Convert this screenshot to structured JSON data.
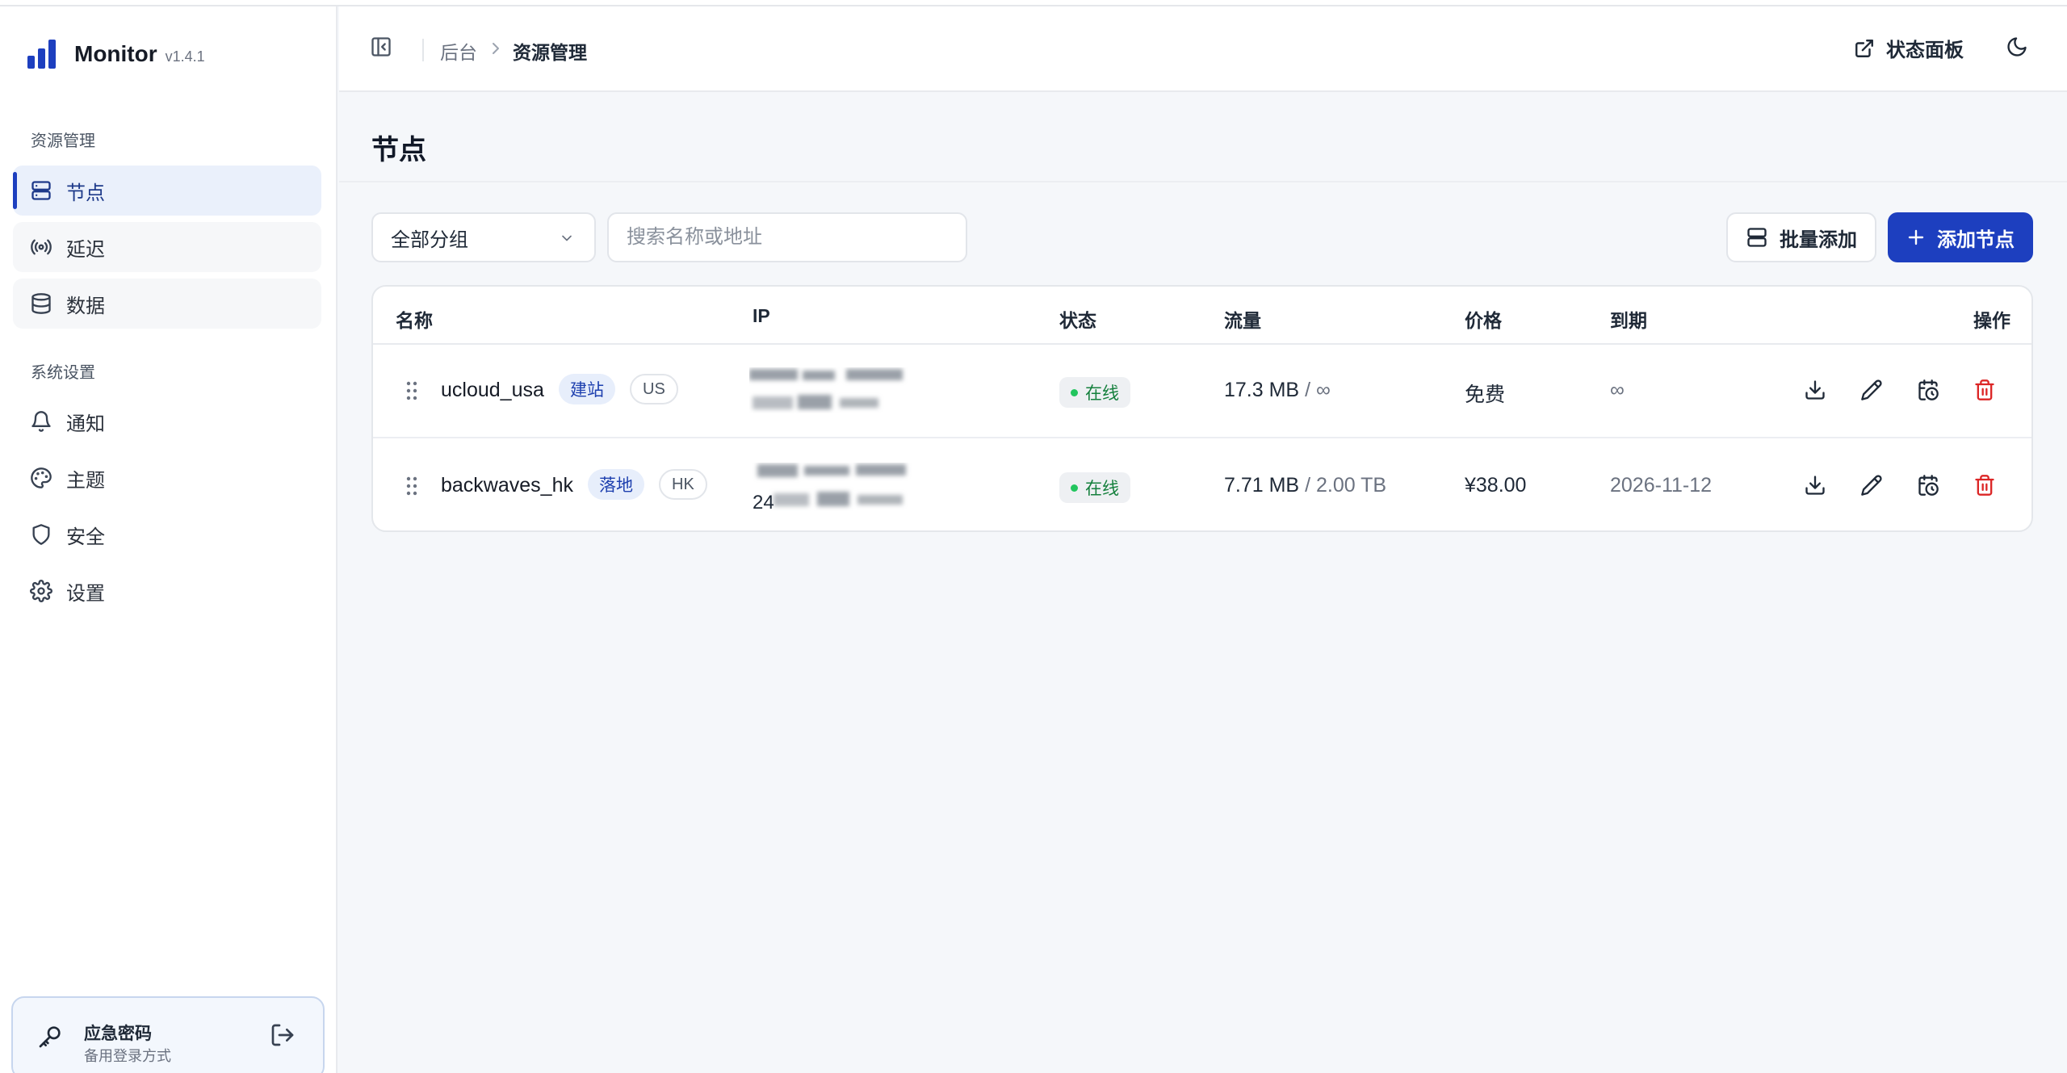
{
  "app": {
    "name": "Monitor",
    "version": "v1.4.1"
  },
  "sidebar": {
    "groups": [
      {
        "title": "资源管理",
        "items": [
          {
            "label": "节点",
            "icon": "server-icon",
            "active": true
          },
          {
            "label": "延迟",
            "icon": "signal-icon"
          },
          {
            "label": "数据",
            "icon": "database-icon"
          }
        ]
      },
      {
        "title": "系统设置",
        "items": [
          {
            "label": "通知",
            "icon": "bell-icon"
          },
          {
            "label": "主题",
            "icon": "palette-icon"
          },
          {
            "label": "安全",
            "icon": "shield-icon"
          },
          {
            "label": "设置",
            "icon": "gear-icon"
          }
        ]
      }
    ],
    "emergency": {
      "title": "应急密码",
      "subtitle": "备用登录方式"
    }
  },
  "header": {
    "breadcrumb": [
      "后台",
      "资源管理"
    ],
    "status_link": "状态面板"
  },
  "page": {
    "title": "节点",
    "filter": {
      "selected": "全部分组"
    },
    "search": {
      "placeholder": "搜索名称或地址",
      "value": ""
    },
    "batch_add_label": "批量添加",
    "add_node_label": "添加节点"
  },
  "table": {
    "columns": [
      "名称",
      "IP",
      "状态",
      "流量",
      "价格",
      "到期",
      "操作"
    ],
    "rows": [
      {
        "name": "ucloud_usa",
        "tag": "建站",
        "region": "US",
        "ip_prefix": "",
        "status": "在线",
        "traffic_used": "17.3 MB",
        "traffic_sep": "/",
        "traffic_cap": "∞",
        "price": "免费",
        "expire": "∞"
      },
      {
        "name": "backwaves_hk",
        "tag": "落地",
        "region": "HK",
        "ip_prefix": "24",
        "status": "在线",
        "traffic_used": "7.71 MB",
        "traffic_sep": "/",
        "traffic_cap": "2.00 TB",
        "price": "¥38.00",
        "expire": "2026-11-12"
      }
    ]
  },
  "colors": {
    "accent": "#1d3fbf",
    "online": "#22c55e",
    "danger": "#dc2626"
  }
}
